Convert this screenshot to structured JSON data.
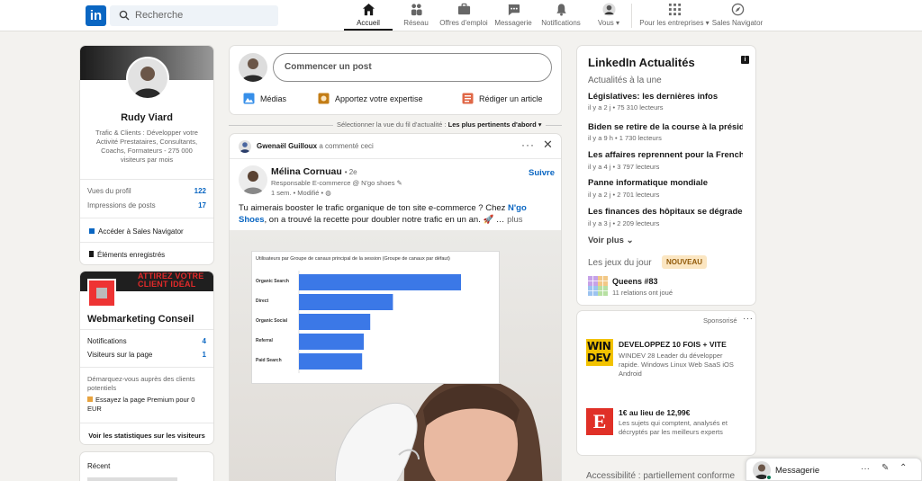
{
  "header": {
    "logo": "in",
    "search_placeholder": "Recherche",
    "nav": [
      {
        "label": "Accueil",
        "icon": "home-icon"
      },
      {
        "label": "Réseau",
        "icon": "network-icon"
      },
      {
        "label": "Offres d'emploi",
        "icon": "briefcase-icon"
      },
      {
        "label": "Messagerie",
        "icon": "message-icon"
      },
      {
        "label": "Notifications",
        "icon": "bell-icon"
      },
      {
        "label": "Vous",
        "icon": "avatar"
      },
      {
        "label": "Pour les entreprises",
        "icon": "grid-icon"
      },
      {
        "label": "Sales Navigator",
        "icon": "compass-icon"
      }
    ]
  },
  "profile": {
    "name": "Rudy Viard",
    "headline": "Trafic & Clients : Développer votre Activité Prestataires, Consultants, Coachs, Formateurs - 275 000 visiteurs par mois",
    "stats": [
      {
        "label": "Vues du profil",
        "value": "122"
      },
      {
        "label": "Impressions de posts",
        "value": "17"
      }
    ],
    "sales_nav": "Accéder à Sales Navigator",
    "saved": "Éléments enregistrés"
  },
  "page_card": {
    "banner_text": "ATTIREZ VOTRE CLIENT IDÉAL",
    "name": "Webmarketing Conseil",
    "stats": [
      {
        "label": "Notifications",
        "value": "4"
      },
      {
        "label": "Visiteurs sur la page",
        "value": "1"
      }
    ],
    "promo": "Démarquez-vous auprès des clients potentiels",
    "premium": "Essayez la page Premium pour 0 EUR",
    "visitors_stats": "Voir les statistiques sur les visiteurs"
  },
  "recent": {
    "label": "Récent"
  },
  "composer": {
    "placeholder": "Commencer un post",
    "actions": [
      {
        "label": "Médias",
        "color": "#378fe9"
      },
      {
        "label": "Apportez votre expertise",
        "color": "#c37d16"
      },
      {
        "label": "Rédiger un article",
        "color": "#e06847"
      }
    ]
  },
  "feed_sort": {
    "prefix": "Sélectionner la vue du fil d'actualité :",
    "value": "Les plus pertinents d'abord"
  },
  "post": {
    "commenter": "Gwenaël Guilloux",
    "commented": "a commenté ceci",
    "author": "Mélina Cornuau",
    "degree": "• 2e",
    "author_title": "Responsable E-commerce @ N'go shoes ✎",
    "meta": "1 sem. • Modifié •",
    "follow": "Suivre",
    "text_1": "Tu aimerais booster le trafic organique de ton site e-commerce ? Chez",
    "brand": "N'go Shoes",
    "text_2": ", on a trouvé la recette pour doubler notre trafic en un an. 🚀 …",
    "more": "plus"
  },
  "chart_data": {
    "type": "bar",
    "title": "Utilisateurs par Groupe de canaux principal de la session (Groupe de canaux par défaut)",
    "categories": [
      "Organic Search",
      "Direct",
      "Organic Social",
      "Referral",
      "Paid Search"
    ],
    "values": [
      100,
      58,
      44,
      40,
      39
    ],
    "orientation": "horizontal",
    "color": "#3b78e7"
  },
  "news": {
    "title": "LinkedIn Actualités",
    "subtitle": "Actualités à la une",
    "items": [
      {
        "title": "Législatives: les dernières infos",
        "meta": "il y a 2 j • 75 310 lecteurs"
      },
      {
        "title": "Biden se retire de la course à la présid…",
        "meta": "il y a 9 h • 1 730 lecteurs"
      },
      {
        "title": "Les affaires reprennent pour la French…",
        "meta": "il y a 4 j • 3 797 lecteurs"
      },
      {
        "title": "Panne informatique mondiale",
        "meta": "il y a 2 j • 2 701 lecteurs"
      },
      {
        "title": "Les finances des hôpitaux se dégradent",
        "meta": "il y a 3 j • 2 209 lecteurs"
      }
    ],
    "more": "Voir plus",
    "games_label": "Les jeux du jour",
    "games_badge": "NOUVEAU",
    "game_name": "Queens #83",
    "game_meta": "11 relations ont joué"
  },
  "ads": {
    "label": "Sponsorisé",
    "items": [
      {
        "logo": "WIN DEV",
        "title": "DEVELOPPEZ 10 FOIS + VITE",
        "desc": "WINDEV 28 Leader du développer rapide. Windows Linux Web SaaS iOS Android"
      },
      {
        "logo": "E",
        "title": "1€ au lieu de 12,99€",
        "desc": "Les sujets qui comptent, analysés et décryptés par les meilleurs experts"
      }
    ]
  },
  "footer": {
    "accessibility": "Accessibilité : partiellement conforme"
  },
  "messaging": {
    "label": "Messagerie"
  }
}
